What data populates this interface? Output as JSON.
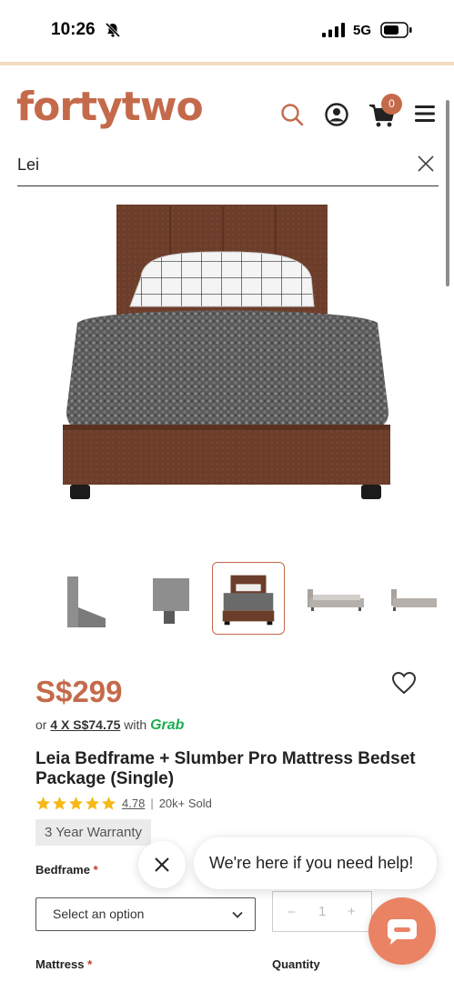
{
  "status_bar": {
    "time": "10:26",
    "network": "5G"
  },
  "header": {
    "logo": "fortytwo",
    "cart_count": "0"
  },
  "search": {
    "value": "Lei"
  },
  "gallery": {
    "thumbnail_count": 5,
    "active_index": 2
  },
  "product": {
    "price": "S$299",
    "installment_prefix": "or",
    "installment_amount": "4 X S$74.75",
    "installment_with": "with",
    "installment_provider": "Grab",
    "title": "Leia Bedframe + Slumber Pro Mattress Bedset Package (Single)",
    "rating": "4.78",
    "rating_stars": 5,
    "sold": "20k+ Sold",
    "warranty": "3 Year Warranty"
  },
  "options": {
    "bedframe_label": "Bedframe",
    "required_mark": "*",
    "bedframe_selected": "Select an option",
    "quantity_minus": "–",
    "quantity_value": "1",
    "quantity_plus": "+",
    "mattress_label": "Mattress",
    "quantity_label": "Quantity"
  },
  "chat": {
    "message": "We're here if you need help!"
  },
  "colors": {
    "brand": "#c46a4b",
    "grab": "#19ad50",
    "chat_fab": "#e98364",
    "star": "#f5b918"
  }
}
